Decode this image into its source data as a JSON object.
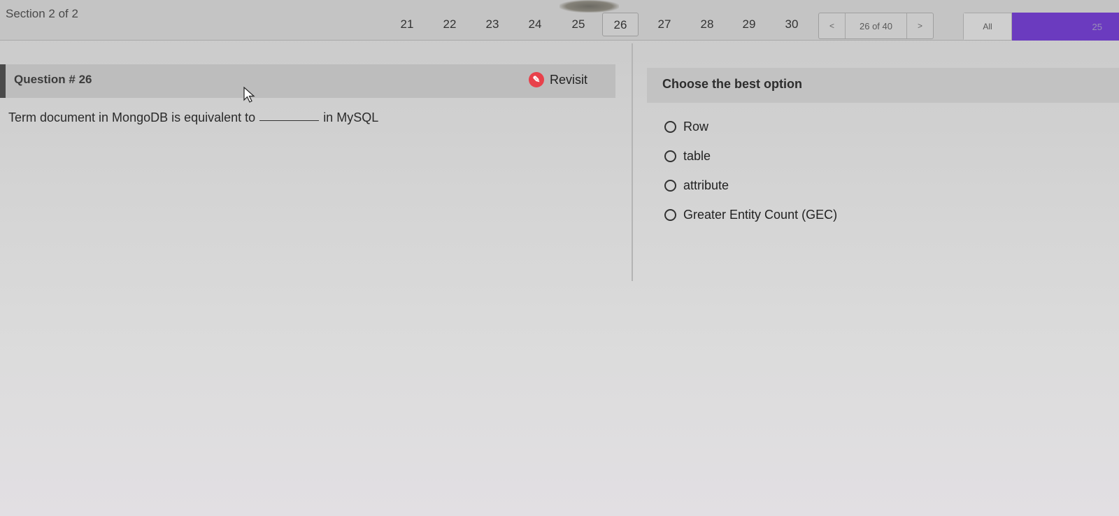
{
  "header": {
    "section": "Section 2 of 2",
    "question_numbers": [
      "21",
      "22",
      "23",
      "24",
      "25",
      "26",
      "27",
      "28",
      "29",
      "30"
    ],
    "active_question": "26",
    "pager": {
      "prev": "<",
      "count": "26 of 40",
      "next": ">"
    },
    "filter": {
      "all_label": "All",
      "count": "25"
    }
  },
  "question": {
    "title": "Question # 26",
    "revisit_label": "Revisit",
    "text_before": "Term document in MongoDB is equivalent to",
    "text_after": "in MySQL"
  },
  "options_panel": {
    "title": "Choose the best option",
    "options": [
      "Row",
      "table",
      "attribute",
      "Greater Entity Count (GEC)"
    ]
  },
  "colors": {
    "accent": "#6b3bbf",
    "revisit": "#e8414b"
  }
}
